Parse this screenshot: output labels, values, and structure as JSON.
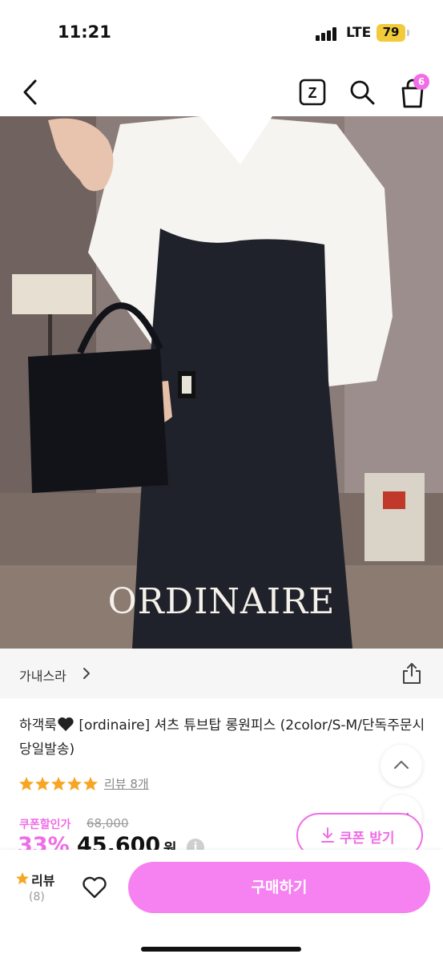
{
  "status_bar": {
    "time": "11:21",
    "network": "LTE",
    "battery": "79",
    "battery_color": "#f2cb3a"
  },
  "nav": {
    "icons": [
      "chevron-left-icon",
      "z-icon",
      "search-icon",
      "shopping-bag-icon"
    ],
    "z_label": "Z",
    "cart_badge": "6",
    "badge_color": "#f06de6"
  },
  "product": {
    "image_watermark": "ORDINAIRE",
    "shop_name": "가내스라",
    "title_before_icon": "하객룩",
    "title_icon": "black-heart-icon",
    "title_after_icon": "[ordinaire] 셔츠 튜브탑 롱원피스 (2color/S-M/단독주문시당일발송)",
    "rating": 5,
    "review_link": "리뷰 8개",
    "coupon_price_label": "쿠폰할인가",
    "original_price": "68,000",
    "discount_rate": "33%",
    "sale_price": "45,600",
    "currency": "원",
    "price_info_icon": "i",
    "coupon_button": "쿠폰 받기",
    "accent_color": "#f06de6"
  },
  "bottom_bar": {
    "review_label": "리뷰",
    "review_count": "(8)",
    "buy_button": "구매하기",
    "buy_button_color": "#f582f0"
  }
}
